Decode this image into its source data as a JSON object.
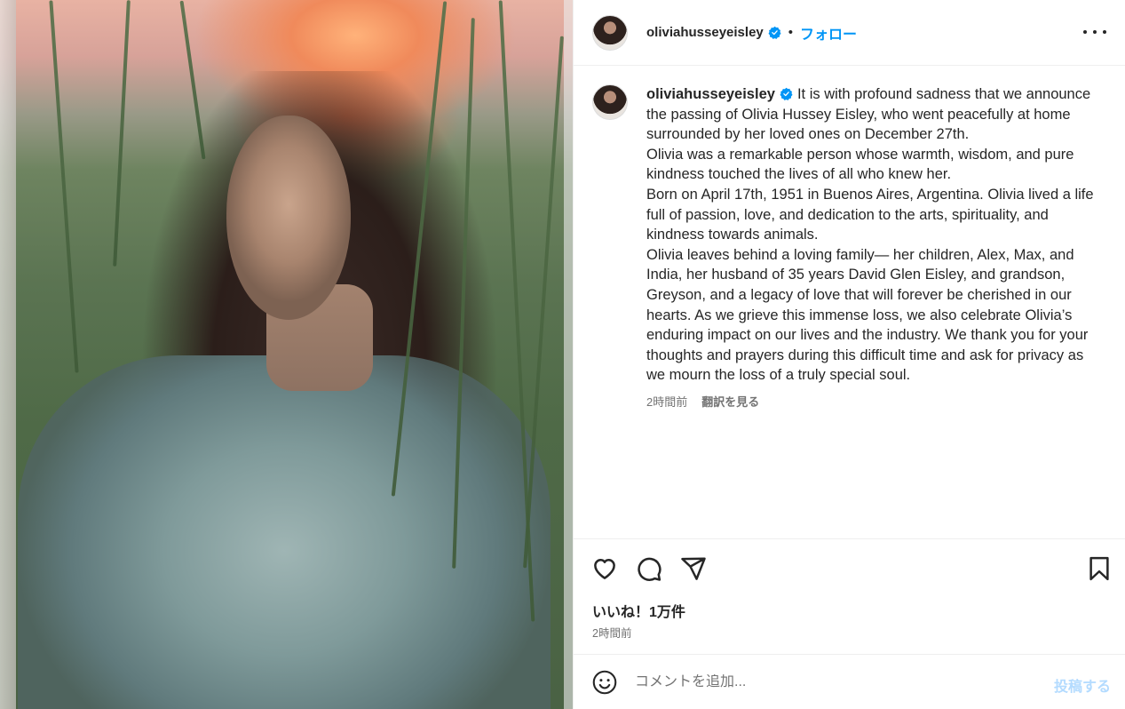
{
  "header": {
    "username": "oliviahusseyeisley",
    "dot": "•",
    "follow_label": "フォロー",
    "more_icon": "more-horizontal-icon"
  },
  "caption": {
    "username": "oliviahusseyeisley",
    "text": "It is with profound sadness that we announce the passing of Olivia Hussey Eisley, who went peacefully at home surrounded by her loved ones on December 27th.\nOlivia was a remarkable person whose warmth, wisdom, and pure kindness touched the lives of all who knew her.\nBorn on April 17th, 1951 in Buenos Aires, Argentina. Olivia lived a life full of passion, love, and dedication to the arts, spirituality, and kindness towards animals.\nOlivia leaves behind a loving family— her children, Alex, Max, and India, her husband of 35 years David Glen Eisley, and grandson, Greyson, and a legacy of love that will forever be cherished in our hearts. As we grieve this immense loss, we also celebrate Olivia’s enduring impact on our lives and the industry. We thank you for your thoughts and prayers during this difficult time and ask for privacy as we mourn the loss of a truly special soul.",
    "time": "2時間前",
    "translate_label": "翻訳を見る"
  },
  "actions": {
    "icons": [
      "heart-icon",
      "comment-icon",
      "share-icon",
      "bookmark-icon"
    ],
    "likes_label": "いいね！1万件",
    "time_label": "2時間前"
  },
  "comment": {
    "placeholder": "コメントを追加...",
    "post_label": "投稿する",
    "emoji_icon": "emoji-icon"
  },
  "colors": {
    "accent": "#0095f6",
    "verified": "#0095f6",
    "post_disabled": "#b3dbff",
    "secondary_text": "#737373"
  }
}
